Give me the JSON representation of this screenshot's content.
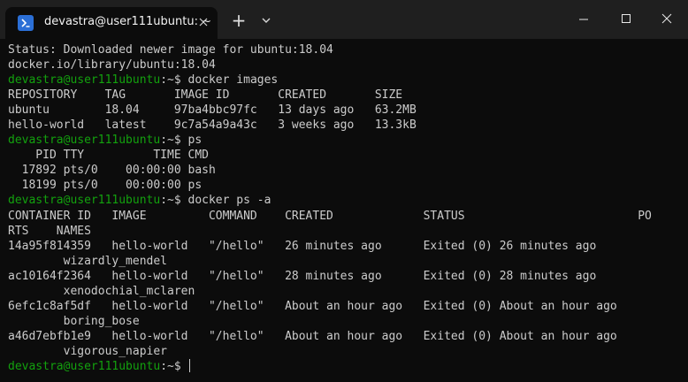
{
  "window": {
    "tab_title": "devastra@user111ubuntu: ~",
    "tab_icon": "terminal-prompt-icon",
    "new_tab_label": "+",
    "accent": "#2b6fd6"
  },
  "colors": {
    "background": "#0c0c0c",
    "titlebar": "#1f1f1f",
    "text": "#cccccc",
    "prompt": "#13a10e"
  },
  "terminal": {
    "lines": [
      {
        "type": "out",
        "text": "Status: Downloaded newer image for ubuntu:18.04"
      },
      {
        "type": "out",
        "text": "docker.io/library/ubuntu:18.04"
      },
      {
        "type": "cmd",
        "prompt": "devastra@user111ubuntu",
        "sep": ":~$ ",
        "command": "docker images"
      },
      {
        "type": "out",
        "text": "REPOSITORY    TAG       IMAGE ID       CREATED       SIZE"
      },
      {
        "type": "out",
        "text": "ubuntu        18.04     97ba4bbc97fc   13 days ago   63.2MB"
      },
      {
        "type": "out",
        "text": "hello-world   latest    9c7a54a9a43c   3 weeks ago   13.3kB"
      },
      {
        "type": "cmd",
        "prompt": "devastra@user111ubuntu",
        "sep": ":~$ ",
        "command": "ps"
      },
      {
        "type": "out",
        "text": "    PID TTY          TIME CMD"
      },
      {
        "type": "out",
        "text": "  17892 pts/0    00:00:00 bash"
      },
      {
        "type": "out",
        "text": "  18199 pts/0    00:00:00 ps"
      },
      {
        "type": "cmd",
        "prompt": "devastra@user111ubuntu",
        "sep": ":~$ ",
        "command": "docker ps -a"
      },
      {
        "type": "out",
        "text": "CONTAINER ID   IMAGE         COMMAND    CREATED             STATUS                         PO"
      },
      {
        "type": "out",
        "text": "RTS    NAMES"
      },
      {
        "type": "out",
        "text": "14a95f814359   hello-world   \"/hello\"   26 minutes ago      Exited (0) 26 minutes ago"
      },
      {
        "type": "out",
        "text": "        wizardly_mendel"
      },
      {
        "type": "out",
        "text": "ac10164f2364   hello-world   \"/hello\"   28 minutes ago      Exited (0) 28 minutes ago"
      },
      {
        "type": "out",
        "text": "        xenodochial_mclaren"
      },
      {
        "type": "out",
        "text": "6efc1c8af5df   hello-world   \"/hello\"   About an hour ago   Exited (0) About an hour ago"
      },
      {
        "type": "out",
        "text": "        boring_bose"
      },
      {
        "type": "out",
        "text": "a46d7ebfb1e9   hello-world   \"/hello\"   About an hour ago   Exited (0) About an hour ago"
      },
      {
        "type": "out",
        "text": "        vigorous_napier"
      },
      {
        "type": "cmd",
        "prompt": "devastra@user111ubuntu",
        "sep": ":~$ ",
        "command": "",
        "cursor": true
      }
    ]
  }
}
